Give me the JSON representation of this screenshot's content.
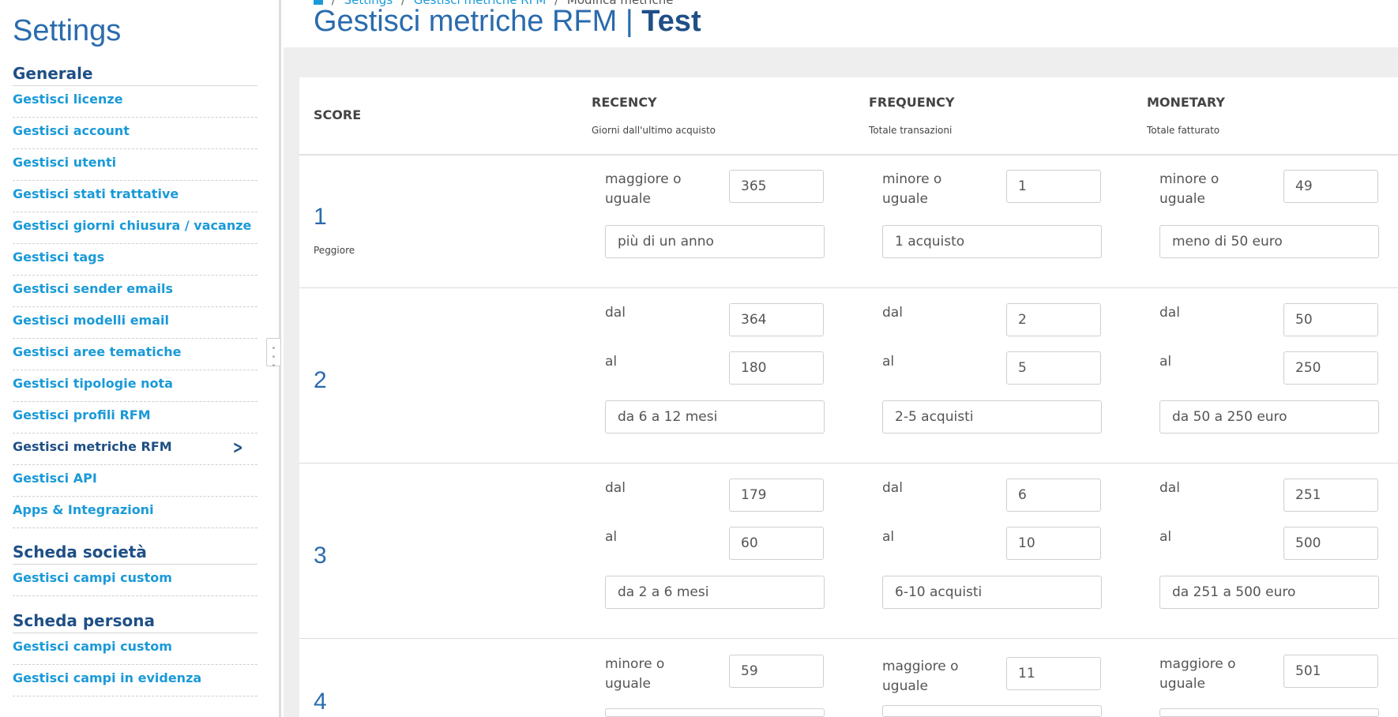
{
  "sidebar": {
    "title": "Settings",
    "sections": [
      {
        "heading": "Generale"
      },
      {
        "heading": "Scheda società"
      },
      {
        "heading": "Scheda persona"
      }
    ],
    "items": [
      {
        "label": "Gestisci licenze"
      },
      {
        "label": "Gestisci account"
      },
      {
        "label": "Gestisci utenti"
      },
      {
        "label": "Gestisci stati trattative"
      },
      {
        "label": "Gestisci giorni chiusura / vacanze"
      },
      {
        "label": "Gestisci tags"
      },
      {
        "label": "Gestisci sender emails"
      },
      {
        "label": "Gestisci modelli email"
      },
      {
        "label": "Gestisci aree tematiche"
      },
      {
        "label": "Gestisci tipologie nota"
      },
      {
        "label": "Gestisci profili RFM"
      },
      {
        "label": "Gestisci metriche RFM",
        "active": true
      },
      {
        "label": "Gestisci API"
      },
      {
        "label": "Apps & Integrazioni"
      },
      {
        "label": "Gestisci campi custom"
      },
      {
        "label": "Gestisci campi custom"
      },
      {
        "label": "Gestisci campi in evidenza"
      }
    ]
  },
  "breadcrumb": {
    "items": [
      "Settings",
      "Gestisci metriche RFM",
      "Modifica metriche"
    ]
  },
  "page": {
    "title": "Gestisci metriche RFM",
    "separator": "|",
    "subtitle": "Test"
  },
  "table": {
    "headers": {
      "score": "SCORE",
      "recency": "RECENCY",
      "recency_sub": "Giorni dall'ultimo acquisto",
      "frequency": "FREQUENCY",
      "frequency_sub": "Totale transazioni",
      "monetary": "MONETARY",
      "monetary_sub": "Totale fatturato"
    },
    "rows": [
      {
        "score": "1",
        "score_label": "Peggiore",
        "recency": {
          "op": "maggiore o uguale",
          "value": "365",
          "desc": "più di un anno"
        },
        "frequency": {
          "op": "minore o uguale",
          "value": "1",
          "desc": "1 acquisto"
        },
        "monetary": {
          "op": "minore o uguale",
          "value": "49",
          "desc": "meno di 50 euro"
        }
      },
      {
        "score": "2",
        "recency": {
          "from_label": "dal",
          "from": "364",
          "to_label": "al",
          "to": "180",
          "desc": "da 6 a 12 mesi"
        },
        "frequency": {
          "from_label": "dal",
          "from": "2",
          "to_label": "al",
          "to": "5",
          "desc": "2-5 acquisti"
        },
        "monetary": {
          "from_label": "dal",
          "from": "50",
          "to_label": "al",
          "to": "250",
          "desc": "da 50 a 250 euro"
        }
      },
      {
        "score": "3",
        "recency": {
          "from_label": "dal",
          "from": "179",
          "to_label": "al",
          "to": "60",
          "desc": "da 2 a 6 mesi"
        },
        "frequency": {
          "from_label": "dal",
          "from": "6",
          "to_label": "al",
          "to": "10",
          "desc": "6-10 acquisti"
        },
        "monetary": {
          "from_label": "dal",
          "from": "251",
          "to_label": "al",
          "to": "500",
          "desc": "da 251 a 500 euro"
        }
      },
      {
        "score": "4",
        "recency": {
          "op": "minore o uguale",
          "value": "59"
        },
        "frequency": {
          "op": "maggiore o uguale",
          "value": "11"
        },
        "monetary": {
          "op": "maggiore o uguale",
          "value": "501"
        }
      }
    ]
  },
  "icons": {
    "home": "home-icon",
    "chevron": "chevron-right-icon",
    "handle": "drag-handle-icon"
  }
}
